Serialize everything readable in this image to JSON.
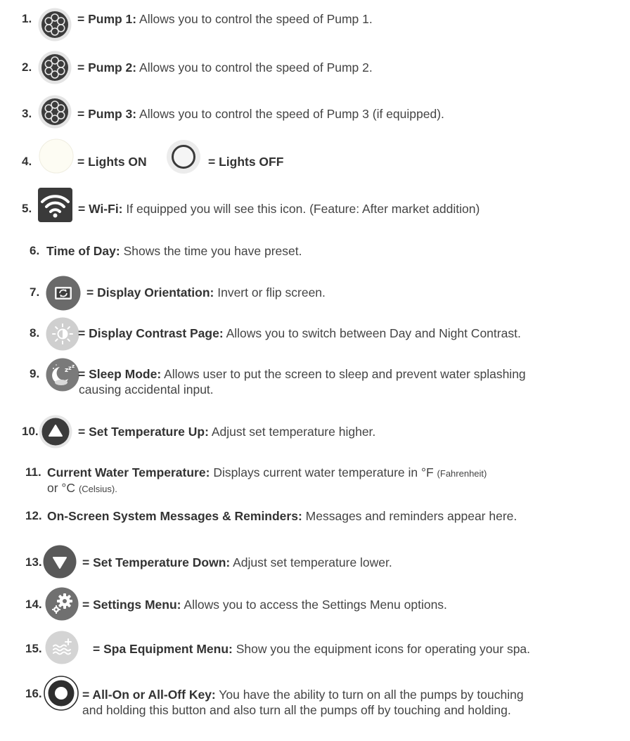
{
  "items": [
    {
      "num": "1.",
      "label": "= Pump 1:",
      "desc": "Allows you to control the speed of Pump 1.",
      "icon": "pump-icon"
    },
    {
      "num": "2.",
      "label": "= Pump 2:",
      "desc": "Allows you to control the speed of Pump 2.",
      "icon": "pump-icon"
    },
    {
      "num": "3.",
      "label": "= Pump 3:",
      "desc": "Allows you to control the speed of Pump 3 (if equipped).",
      "icon": "pump-icon"
    },
    {
      "num": "4.",
      "label": "= Lights ON",
      "label2": "= Lights OFF",
      "icon": "lights-on-icon",
      "icon2": "lights-off-icon"
    },
    {
      "num": "5.",
      "label": "= Wi-Fi:",
      "desc": "If equipped you will see this icon. (Feature: After market addition)",
      "icon": "wifi-icon"
    },
    {
      "num": "6.",
      "label": "Time of Day:",
      "desc": "Shows the time you have preset."
    },
    {
      "num": "7.",
      "label": "= Display Orientation:",
      "desc": "Invert or flip screen.",
      "icon": "display-orientation-icon"
    },
    {
      "num": "8.",
      "label": "= Display Contrast Page:",
      "desc": "Allows you to switch between Day and Night Contrast.",
      "icon": "contrast-sun-icon"
    },
    {
      "num": "9.",
      "label": "= Sleep Mode:",
      "desc": "Allows user to put the screen to sleep and prevent water splashing",
      "desc2": "causing accidental input.",
      "icon": "sleep-moon-icon"
    },
    {
      "num": "10.",
      "label": "= Set Temperature Up:",
      "desc": "Adjust set temperature higher.",
      "icon": "temperature-up-icon"
    },
    {
      "num": "11.",
      "label": "Current Water Temperature:",
      "desc": "Displays current water temperature in °F",
      "desc_small": "(Fahrenheit)",
      "desc2": "or °C",
      "desc2_small": "(Celsius)."
    },
    {
      "num": "12.",
      "label": "On-Screen System Messages & Reminders:",
      "desc": "Messages and reminders appear here."
    },
    {
      "num": "13.",
      "label": "= Set Temperature Down:",
      "desc": "Adjust set temperature lower.",
      "icon": "temperature-down-icon"
    },
    {
      "num": "14.",
      "label": "= Settings Menu:",
      "desc": "Allows you to access the Settings Menu options.",
      "icon": "settings-gears-icon"
    },
    {
      "num": "15.",
      "label": "= Spa Equipment Menu:",
      "desc": "Show you the equipment icons for operating your spa.",
      "icon": "spa-equipment-icon"
    },
    {
      "num": "16.",
      "label": "= All-On or All-Off Key:",
      "desc": "You have the ability to turn on all the pumps by touching",
      "desc2": "and holding this button and also turn all the pumps off by touching and holding.",
      "icon": "all-on-off-icon"
    }
  ]
}
